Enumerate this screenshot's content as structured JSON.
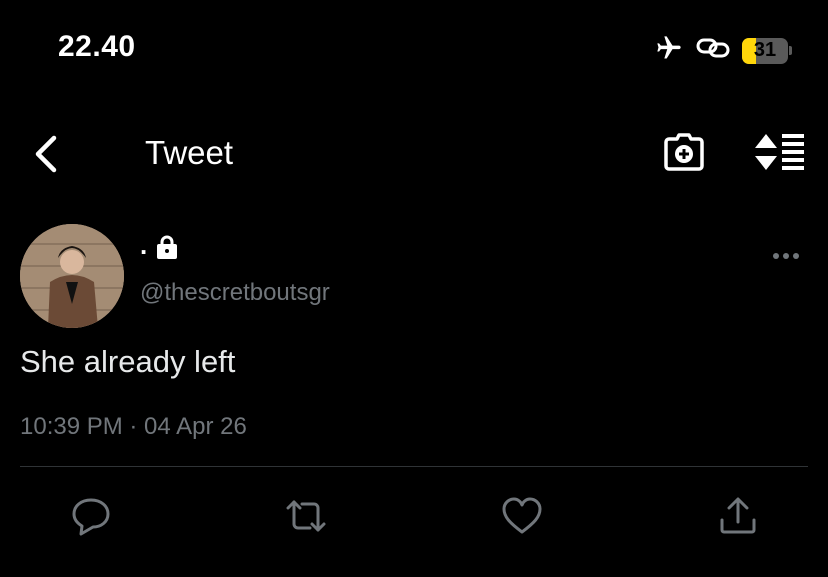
{
  "status_bar": {
    "time": "22.40",
    "battery": "31",
    "battery_level": 0.31,
    "icons": [
      "airplane-icon",
      "link-icon",
      "battery-icon"
    ]
  },
  "nav": {
    "title": "Tweet",
    "icons": [
      "back-chevron-icon",
      "camera-add-icon",
      "sort-icon"
    ]
  },
  "tweet": {
    "display_name": ".",
    "handle": "@thescretboutsgr",
    "text": "She already left",
    "timestamp": "10:39 PM · 04 Apr 26",
    "protected_icon": "lock-icon"
  },
  "actions": [
    "reply-icon",
    "retweet-icon",
    "like-icon",
    "share-icon"
  ],
  "colors": {
    "background": "#000000",
    "text": "#e7e9ea",
    "secondary": "#71767b",
    "divider": "#2f3336",
    "battery_accent": "#ffd60a"
  }
}
